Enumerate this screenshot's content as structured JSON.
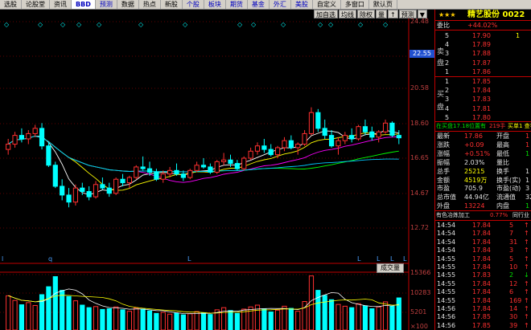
{
  "toolbar": [
    {
      "label": "选股",
      "style": ""
    },
    {
      "label": "论股堂",
      "style": ""
    },
    {
      "label": "资讯",
      "style": ""
    },
    {
      "label": "BBD",
      "style": "active"
    },
    {
      "label": "预测",
      "style": "blue"
    },
    {
      "label": "数据",
      "style": ""
    },
    {
      "label": "热点",
      "style": ""
    },
    {
      "label": "新股",
      "style": ""
    },
    {
      "label": "个股",
      "style": "blue"
    },
    {
      "label": "板块",
      "style": "blue"
    },
    {
      "label": "期货",
      "style": "blue"
    },
    {
      "label": "基金",
      "style": "blue"
    },
    {
      "label": "外汇",
      "style": "blue"
    },
    {
      "label": "美股",
      "style": "blue"
    },
    {
      "label": "自定义",
      "style": ""
    },
    {
      "label": "多窗口",
      "style": ""
    },
    {
      "label": "默认页",
      "style": ""
    }
  ],
  "chart_tools": [
    "加自选",
    "均线",
    "除权",
    "量",
    "↑",
    "预测",
    "▼"
  ],
  "price_axis": [
    "24.48",
    "22.55",
    "20.58",
    "18.60",
    "16.65",
    "14.67",
    "12.72"
  ],
  "price_highlight": "22.55",
  "volume_axis": [
    "15366",
    "10283",
    "5201",
    "×100"
  ],
  "volume_label": "成交量",
  "top_markers": [
    "◇",
    "◇",
    "◇",
    "◇",
    "◇",
    "◇",
    "◇",
    "◇",
    "◇",
    "◇",
    "◇",
    "◇",
    "◇",
    "◇"
  ],
  "bottom_markers": [
    "l",
    "q",
    "L",
    "L",
    "L",
    "L",
    "L"
  ],
  "colors": {
    "up": "#ff3030",
    "down": "#00ffff",
    "ma5": "#ffffff",
    "ma10": "#ffff00",
    "ma20": "#ff00ff",
    "ma60": "#00ff00",
    "ma120": "#00c8ff"
  },
  "chart_data": {
    "type": "candlestick",
    "ylim": [
      12.72,
      24.48
    ],
    "candles": [
      [
        17.2,
        17.8,
        16.9,
        17.5
      ],
      [
        17.5,
        18.2,
        17.3,
        18.0
      ],
      [
        18.0,
        18.4,
        17.6,
        17.8
      ],
      [
        17.8,
        18.3,
        17.5,
        18.1
      ],
      [
        18.1,
        18.6,
        17.9,
        18.4
      ],
      [
        18.4,
        18.7,
        17.2,
        17.4
      ],
      [
        17.4,
        17.6,
        16.2,
        16.3
      ],
      [
        16.3,
        16.5,
        15.0,
        15.1
      ],
      [
        15.1,
        15.5,
        14.3,
        14.6
      ],
      [
        14.6,
        15.0,
        13.9,
        14.2
      ],
      [
        14.2,
        15.2,
        14.0,
        15.0
      ],
      [
        15.0,
        15.3,
        14.6,
        14.8
      ],
      [
        14.8,
        15.1,
        14.3,
        14.5
      ],
      [
        14.5,
        15.4,
        14.4,
        15.2
      ],
      [
        15.2,
        15.6,
        14.9,
        15.0
      ],
      [
        15.0,
        15.3,
        14.5,
        14.7
      ],
      [
        14.7,
        15.6,
        14.6,
        15.5
      ],
      [
        15.5,
        15.8,
        15.1,
        15.3
      ],
      [
        15.3,
        15.7,
        15.0,
        15.6
      ],
      [
        15.6,
        16.3,
        15.5,
        16.2
      ],
      [
        16.2,
        16.8,
        16.0,
        16.1
      ],
      [
        16.1,
        16.5,
        15.7,
        15.9
      ],
      [
        15.9,
        16.1,
        15.4,
        15.5
      ],
      [
        15.5,
        16.0,
        15.3,
        15.8
      ],
      [
        15.8,
        16.2,
        15.6,
        16.0
      ],
      [
        16.0,
        16.4,
        15.7,
        15.8
      ],
      [
        15.8,
        16.0,
        15.4,
        15.6
      ],
      [
        15.6,
        16.1,
        15.5,
        16.0
      ],
      [
        16.0,
        16.5,
        15.9,
        16.3
      ],
      [
        16.3,
        16.7,
        16.1,
        16.2
      ],
      [
        16.2,
        16.4,
        15.8,
        15.9
      ],
      [
        15.9,
        16.6,
        15.8,
        16.5
      ],
      [
        16.5,
        17.0,
        16.3,
        16.6
      ],
      [
        16.6,
        16.9,
        16.2,
        16.4
      ],
      [
        16.4,
        16.6,
        16.0,
        16.1
      ],
      [
        16.1,
        16.8,
        16.0,
        16.7
      ],
      [
        16.7,
        17.3,
        16.6,
        17.1
      ],
      [
        17.1,
        17.6,
        16.9,
        17.4
      ],
      [
        17.4,
        17.8,
        17.0,
        17.2
      ],
      [
        17.2,
        17.5,
        16.8,
        16.9
      ],
      [
        16.9,
        17.4,
        16.7,
        17.3
      ],
      [
        17.3,
        17.9,
        17.1,
        17.7
      ],
      [
        17.7,
        18.0,
        17.2,
        17.3
      ],
      [
        17.3,
        17.6,
        16.9,
        17.5
      ],
      [
        17.5,
        18.3,
        17.4,
        18.1
      ],
      [
        18.1,
        19.6,
        18.0,
        19.3
      ],
      [
        19.3,
        19.5,
        18.2,
        18.4
      ],
      [
        18.4,
        18.9,
        17.8,
        18.0
      ],
      [
        18.0,
        18.3,
        17.3,
        17.4
      ],
      [
        17.4,
        17.9,
        16.9,
        17.7
      ],
      [
        17.7,
        18.2,
        17.5,
        18.0
      ],
      [
        18.0,
        18.4,
        17.6,
        17.8
      ],
      [
        17.8,
        18.6,
        17.7,
        18.5
      ],
      [
        18.5,
        18.9,
        18.0,
        18.2
      ],
      [
        18.2,
        18.5,
        17.7,
        17.9
      ],
      [
        17.9,
        18.3,
        17.6,
        18.2
      ],
      [
        18.2,
        18.9,
        18.1,
        18.7
      ],
      [
        18.7,
        18.8,
        17.9,
        18.0
      ],
      [
        18.0,
        18.3,
        17.5,
        17.86
      ]
    ],
    "volumes": [
      9500,
      8200,
      7000,
      7600,
      6800,
      9800,
      12000,
      14800,
      11000,
      9300,
      8100,
      6900,
      6200,
      6500,
      5700,
      5900,
      6400,
      5600,
      5200,
      6100,
      5800,
      5300,
      4600,
      4900,
      4400,
      4700,
      4200,
      4500,
      5100,
      4800,
      4300,
      5600,
      6200,
      5400,
      4600,
      5800,
      6400,
      6900,
      5900,
      5000,
      5500,
      6600,
      6000,
      5200,
      7900,
      15000,
      11000,
      9600,
      8400,
      7100,
      6600,
      6200,
      7300,
      6700,
      5900,
      6400,
      7800,
      6600,
      8900
    ],
    "series": [
      {
        "name": "MA5",
        "values": []
      },
      {
        "name": "MA10",
        "values": []
      },
      {
        "name": "MA20",
        "values": []
      },
      {
        "name": "MA60",
        "values": []
      }
    ]
  },
  "panel": {
    "stars": "★★★",
    "name": "精艺股份 0022",
    "weibi_label": "委比",
    "weibi_value": "+44.02%",
    "sell_label_1": "卖",
    "sell_label_2": "盘",
    "buy_label_1": "买",
    "buy_label_2": "盘",
    "sell": [
      {
        "n": "5",
        "p": "17.90",
        "v": "1"
      },
      {
        "n": "4",
        "p": "17.89",
        "v": ""
      },
      {
        "n": "3",
        "p": "17.88",
        "v": ""
      },
      {
        "n": "2",
        "p": "17.87",
        "v": ""
      },
      {
        "n": "1",
        "p": "17.86",
        "v": ""
      }
    ],
    "buy": [
      {
        "n": "1",
        "p": "17.85",
        "v": ""
      },
      {
        "n": "2",
        "p": "17.84",
        "v": ""
      },
      {
        "n": "3",
        "p": "17.83",
        "v": ""
      },
      {
        "n": "4",
        "p": "17.81",
        "v": ""
      },
      {
        "n": "5",
        "p": "17.80",
        "v": ""
      }
    ],
    "tag_line_left": "在买盘17.18位置有",
    "tag_line_mid": "219手",
    "tag_line_right": "买单1 查看",
    "stats": [
      {
        "l": "最新",
        "v": "17.86",
        "vc": "red",
        "l2": "开盘",
        "v2": "1",
        "v2c": "red"
      },
      {
        "l": "涨跌",
        "v": "+0.09",
        "vc": "red",
        "l2": "最高",
        "v2": "1",
        "v2c": "red"
      },
      {
        "l": "涨幅",
        "v": "+0.51%",
        "vc": "red",
        "l2": "最低",
        "v2": "1",
        "v2c": "green"
      },
      {
        "l": "振幅",
        "v": "2.03%",
        "vc": "white",
        "l2": "量比",
        "v2": "",
        "v2c": "white"
      },
      {
        "l": "总手",
        "v": "25215",
        "vc": "yellow",
        "l2": "换手",
        "v2": "1",
        "v2c": "white"
      },
      {
        "l": "金额",
        "v": "4519万",
        "vc": "yellow",
        "l2": "换手(实)",
        "v2": "1",
        "v2c": "white"
      },
      {
        "l": "市盈",
        "v": "705.9",
        "vc": "white",
        "l2": "市盈(动)",
        "v2": "3",
        "v2c": "white"
      },
      {
        "l": "总市值",
        "v": "44.94亿",
        "vc": "white",
        "l2": "流通值",
        "v2": "32.",
        "v2c": "white"
      },
      {
        "l": "外盘",
        "v": "13224",
        "vc": "red",
        "l2": "内盘",
        "v2": "1",
        "v2c": "green"
      }
    ],
    "industry_left": "有色冶炼加工",
    "industry_mid": "0.77%",
    "industry_right": "同行业",
    "ticks": [
      {
        "t": "14:54",
        "p": "17.84",
        "v": "5",
        "d": "up"
      },
      {
        "t": "14:54",
        "p": "17.84",
        "v": "7",
        "d": "up"
      },
      {
        "t": "14:54",
        "p": "17.84",
        "v": "31",
        "d": "up"
      },
      {
        "t": "14:54",
        "p": "17.84",
        "v": "3",
        "d": "up"
      },
      {
        "t": "14:55",
        "p": "17.84",
        "v": "5",
        "d": "up"
      },
      {
        "t": "14:55",
        "p": "17.84",
        "v": "10",
        "d": "up"
      },
      {
        "t": "14:55",
        "p": "17.83",
        "v": "2",
        "d": "dn"
      },
      {
        "t": "14:55",
        "p": "17.84",
        "v": "12",
        "d": "up"
      },
      {
        "t": "14:55",
        "p": "17.84",
        "v": "6",
        "d": "up"
      },
      {
        "t": "14:55",
        "p": "17.84",
        "v": "169",
        "d": "up"
      },
      {
        "t": "14:56",
        "p": "17.84",
        "v": "14",
        "d": "up"
      },
      {
        "t": "14:56",
        "p": "17.85",
        "v": "30",
        "d": "up"
      },
      {
        "t": "14:56",
        "p": "17.85",
        "v": "39",
        "d": "up"
      }
    ]
  }
}
